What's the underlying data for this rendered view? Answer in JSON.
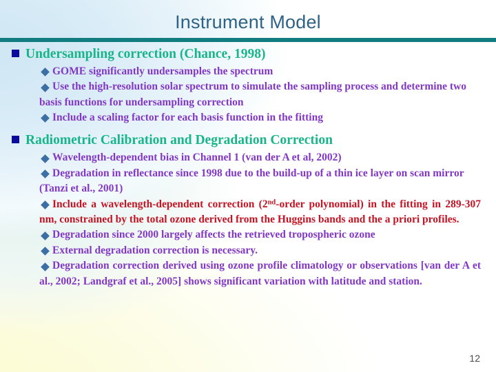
{
  "slide": {
    "title": "Instrument Model",
    "page_number": "12",
    "title_color": "#2e6286",
    "rule_color": "#127d81",
    "heading_color": "#18b58a",
    "square_bullet_color": "#0b0b9e",
    "diamond_bullet_color": "#3c6fa4",
    "purple_text_color": "#8238c4",
    "red_text_color": "#c41424"
  },
  "sections": [
    {
      "heading": "Undersampling correction (Chance, 1998)",
      "bullets": [
        {
          "text": "GOME significantly undersamples the spectrum",
          "color": "purple",
          "justify": false
        },
        {
          "text": "Use the high-resolution solar spectrum to simulate the sampling process and determine two basis functions for undersampling correction",
          "color": "purple",
          "justify": false
        },
        {
          "text": "Include a scaling factor for each basis function in the fitting",
          "color": "purple",
          "justify": false
        }
      ]
    },
    {
      "heading": "Radiometric Calibration and Degradation Correction",
      "bullets": [
        {
          "text": "Wavelength-dependent bias in Channel 1 (van der A et al, 2002)",
          "color": "purple",
          "justify": false
        },
        {
          "text": "Degradation in reflectance since 1998 due to the build-up of a thin ice layer on scan mirror (Tanzi et al., 2001)",
          "color": "purple",
          "justify": false
        },
        {
          "text_pre": "Include a wavelength-dependent correction (2",
          "superscript": "nd",
          "text_post": "-order polynomial) in the fitting in 289-307 nm, constrained by the total ozone derived from the Huggins bands and the a priori profiles.",
          "color": "red",
          "justify": true
        },
        {
          "text": "Degradation since 2000 largely affects the retrieved tropospheric ozone",
          "color": "purple",
          "justify": false
        },
        {
          "text": "External degradation correction is necessary.",
          "color": "purple",
          "justify": false
        },
        {
          "text": "Degradation correction derived using ozone profile climatology or observations [van der A et al., 2002; Landgraf et al., 2005] shows significant variation with latitude and station.",
          "color": "purple",
          "justify": true
        }
      ]
    }
  ]
}
